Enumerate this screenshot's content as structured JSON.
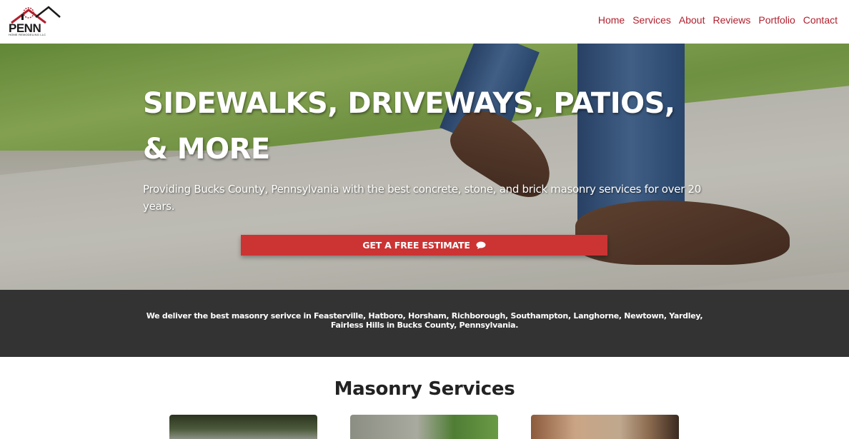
{
  "header": {
    "logo_text": "PENN",
    "logo_subtext": "HOME REMODELING LLC",
    "nav": [
      "Home",
      "Services",
      "About",
      "Reviews",
      "Portfolio",
      "Contact"
    ]
  },
  "hero": {
    "title": "SIDEWALKS, DRIVEWAYS, PATIOS, & MORE",
    "subtitle": "Providing Bucks County, Pennsylvania with the best concrete, stone, and brick masonry services for over 20 years.",
    "cta_label": "GET A FREE ESTIMATE",
    "cta_icon": "speech-bubble-icon"
  },
  "band": {
    "text": "We deliver the best masonry serivce in  Feasterville, Hatboro, Horsham, Richborough, Southampton, Langhorne, Newtown, Yardley, Fairless Hills in Bucks County, Pennsylvania."
  },
  "services": {
    "title": "Masonry Services"
  },
  "colors": {
    "accent": "#cc3333",
    "nav_link": "#b0202e",
    "band_bg": "#333333"
  }
}
